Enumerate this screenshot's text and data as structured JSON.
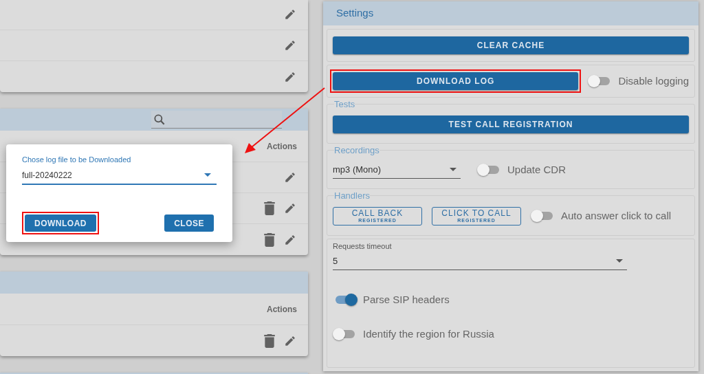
{
  "left_cards": [
    {
      "rows": [
        {
          "kind": "edit"
        },
        {
          "kind": "edit"
        },
        {
          "kind": "edit"
        }
      ]
    },
    {
      "header": true,
      "search": true,
      "columns": [
        "Actions"
      ],
      "rows": [
        {
          "kind": "edit"
        },
        {
          "kind": "delete_edit"
        },
        {
          "kind": "delete_edit"
        }
      ]
    },
    {
      "header": true,
      "search": false,
      "columns": [
        "Actions"
      ],
      "rows": [
        {
          "kind": "delete_edit"
        }
      ]
    },
    {
      "header": true,
      "search": false
    }
  ],
  "dialog": {
    "label": "Chose log file to be Downloaded",
    "value": "full-20240222",
    "buttons": [
      {
        "label": "DOWNLOAD",
        "highlighted": true
      },
      {
        "label": "CLOSE",
        "highlighted": false
      }
    ]
  },
  "settings": {
    "title": "Settings",
    "sections": [
      {
        "kind": "row",
        "items": [
          {
            "kind": "button",
            "label": "CLEAR CACHE",
            "highlighted": false
          }
        ]
      },
      {
        "kind": "row",
        "items": [
          {
            "kind": "button",
            "label": "DOWNLOAD LOG",
            "highlighted": true
          },
          {
            "kind": "toggle",
            "label": "Disable logging",
            "on": false
          }
        ]
      },
      {
        "legend": "Tests",
        "kind": "row",
        "items": [
          {
            "kind": "button",
            "label": "TEST CALL REGISTRATION",
            "highlighted": false
          }
        ]
      },
      {
        "legend": "Recordings",
        "kind": "row",
        "items": [
          {
            "kind": "select",
            "value": "mp3 (Mono)"
          },
          {
            "kind": "toggle",
            "label": "Update CDR",
            "on": false
          }
        ]
      },
      {
        "legend": "Handlers",
        "kind": "row",
        "items": [
          {
            "kind": "outline_button",
            "label": "CALL BACK",
            "sublabel": "REGISTERED"
          },
          {
            "kind": "outline_button",
            "label": "CLICK TO CALL",
            "sublabel": "REGISTERED"
          },
          {
            "kind": "toggle",
            "label": "Auto answer click to call",
            "on": false
          }
        ]
      },
      {
        "kind": "column",
        "items": [
          {
            "kind": "labelled_select",
            "label": "Requests timeout",
            "value": "5"
          },
          {
            "kind": "toggle",
            "label": "Parse SIP headers",
            "on": true
          },
          {
            "kind": "toggle",
            "label": "Identify the region for Russia",
            "on": false
          }
        ]
      }
    ]
  }
}
